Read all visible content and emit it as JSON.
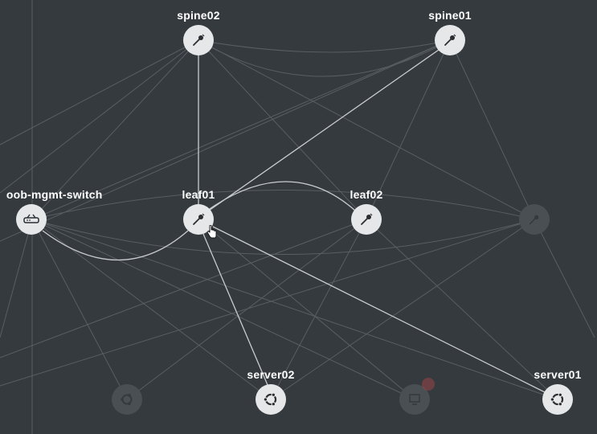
{
  "colors": {
    "background": "#353a3f",
    "node_fill": "#e6e7e8",
    "node_dim_fill": "#4a4f54",
    "edge_bright": "#c9ccce",
    "edge_faint": "#5c6267"
  },
  "nodes": {
    "spine02": {
      "label": "spine02",
      "icon": "switch-pin-icon"
    },
    "spine01": {
      "label": "spine01",
      "icon": "switch-pin-icon"
    },
    "oob": {
      "label": "oob-mgmt-switch",
      "icon": "router-icon"
    },
    "leaf01": {
      "label": "leaf01",
      "icon": "switch-pin-icon"
    },
    "leaf02": {
      "label": "leaf02",
      "icon": "switch-pin-icon"
    },
    "server02": {
      "label": "server02",
      "icon": "ubuntu-icon"
    },
    "server01": {
      "label": "server01",
      "icon": "ubuntu-icon"
    },
    "dim_right": {
      "label": "",
      "icon": "switch-pin-icon"
    },
    "dim_server": {
      "label": "",
      "icon": "ubuntu-icon"
    },
    "dim_host": {
      "label": "",
      "icon": "host-icon"
    }
  },
  "hover": {
    "node": "leaf01",
    "cursor": "hand-pointer-icon"
  }
}
